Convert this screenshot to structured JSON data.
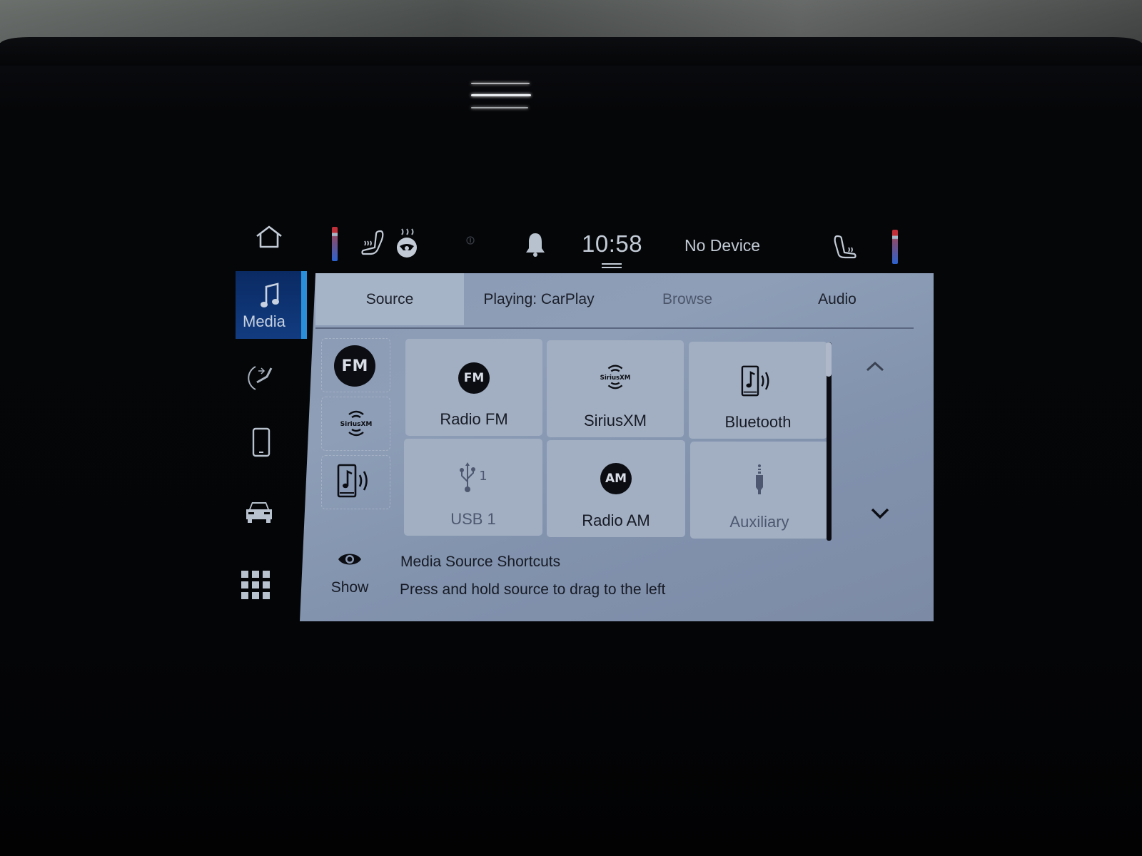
{
  "status_bar": {
    "clock": "10:58",
    "device_status": "No Device",
    "icons": [
      "home-icon",
      "driver-temp-indicator",
      "heated-seat-icon",
      "heated-steering-wheel-icon",
      "info-icon",
      "notification-bell-icon",
      "passenger-heated-seat-icon",
      "passenger-temp-indicator"
    ]
  },
  "rail": {
    "items": [
      {
        "id": "media",
        "label": "Media",
        "icon": "music-note-icon",
        "active": true
      },
      {
        "id": "seat",
        "label": "",
        "icon": "seat-adjust-icon",
        "active": false
      },
      {
        "id": "phone",
        "label": "",
        "icon": "phone-icon",
        "active": false
      },
      {
        "id": "vehicle",
        "label": "",
        "icon": "car-icon",
        "active": false
      },
      {
        "id": "apps",
        "label": "",
        "icon": "app-grid-icon",
        "active": false
      }
    ]
  },
  "tabs": [
    {
      "label": "Source",
      "active": true
    },
    {
      "label": "Playing: CarPlay",
      "active": false
    },
    {
      "label": "Browse",
      "active": false,
      "disabled": true
    },
    {
      "label": "Audio",
      "active": false
    }
  ],
  "shortcuts": [
    {
      "icon": "fm-icon",
      "badge": "FM"
    },
    {
      "icon": "siriusxm-icon",
      "badge": "SiriusXM"
    },
    {
      "icon": "bluetooth-audio-icon",
      "badge": ""
    }
  ],
  "sources": [
    {
      "label": "Radio FM",
      "icon": "fm-icon",
      "badge": "FM",
      "enabled": true
    },
    {
      "label": "SiriusXM",
      "icon": "siriusxm-icon",
      "badge": "SiriusXM",
      "enabled": true
    },
    {
      "label": "Bluetooth",
      "icon": "bluetooth-audio-icon",
      "badge": "",
      "enabled": true
    },
    {
      "label": "USB 1",
      "icon": "usb-icon",
      "badge": "1",
      "enabled": false
    },
    {
      "label": "Radio AM",
      "icon": "am-icon",
      "badge": "AM",
      "enabled": true
    },
    {
      "label": "Auxiliary",
      "icon": "aux-jack-icon",
      "badge": "",
      "enabled": false
    }
  ],
  "scroll": {
    "position_fraction": 0.0,
    "visible_fraction": 0.17
  },
  "footer": {
    "show_label": "Show",
    "title": "Media Source Shortcuts",
    "hint": "Press and hold source to drag to the left"
  }
}
